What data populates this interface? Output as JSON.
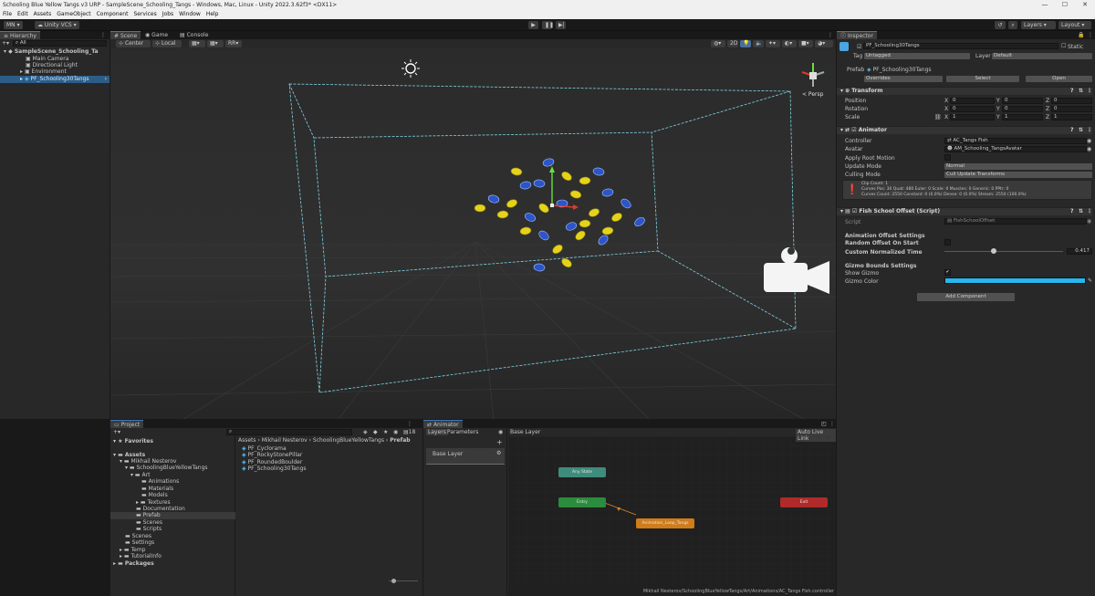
{
  "window": {
    "title": "Schooling Blue Yellow Tangs v3 URP - SampleScene_Schooling_Tangs - Windows, Mac, Linux - Unity 2022.3.62f3* <DX11>",
    "controls": [
      "—",
      "☐",
      "✕"
    ]
  },
  "menu": [
    "File",
    "Edit",
    "Assets",
    "GameObject",
    "Component",
    "Services",
    "Jobs",
    "Window",
    "Help"
  ],
  "toolbar": {
    "account": "MN",
    "vcs": "Unity VCS",
    "layers": "Layers",
    "layout": "Layout"
  },
  "hierarchy": {
    "tab": "Hierarchy",
    "search_placeholder": "All",
    "scene": "SampleScene_Schooling_Ta",
    "items": [
      "Main Camera",
      "Directional Light",
      "Environment",
      "PF_Schooling30Tangs"
    ]
  },
  "scene_view": {
    "tabs": [
      "Scene",
      "Game",
      "Console"
    ],
    "pivot": "Center",
    "space": "Local",
    "mode_2d": "2D",
    "persp": "< Persp",
    "render": "RR"
  },
  "inspector": {
    "tab": "Inspector",
    "object_name": "PF_Schooling30Tangs",
    "static_label": "Static",
    "tag_label": "Tag",
    "tag_value": "Untagged",
    "layer_label": "Layer",
    "layer_value": "Default",
    "prefab_label": "Prefab",
    "prefab_value": "PF_Schooling30Tangs",
    "overrides": "Overrides",
    "select": "Select",
    "open": "Open",
    "transform": {
      "title": "Transform",
      "position_label": "Position",
      "rotation_label": "Rotation",
      "scale_label": "Scale",
      "position": [
        "0",
        "0",
        "0"
      ],
      "rotation": [
        "0",
        "0",
        "0"
      ],
      "scale": [
        "1",
        "1",
        "1"
      ],
      "x": "X",
      "y": "Y",
      "z": "Z"
    },
    "animator": {
      "title": "Animator",
      "controller_label": "Controller",
      "controller": "AC_Tangs Fish",
      "avatar_label": "Avatar",
      "avatar": "AM_Schooling_TangsAvatar",
      "apply_root_motion_label": "Apply Root Motion",
      "update_mode_label": "Update Mode",
      "update_mode": "Normal",
      "culling_mode_label": "Culling Mode",
      "culling_mode": "Cull Update Transforms",
      "info_1": "Clip Count: 1",
      "info_2": "Curves Pos: 30 Quat: 480 Euler: 0 Scale: 0 Muscles: 0 Generic: 0 PPtr: 0",
      "info_3": "Curves Count: 2550 Constant: 0 (0.0%) Dense: 0 (0.0%) Stream: 2550 (100.0%)"
    },
    "fish_school": {
      "title": "Fish School Offset (Script)",
      "script_label": "Script",
      "script": "FishSchoolOffset",
      "anim_settings": "Animation Offset Settings",
      "random_offset_label": "Random Offset On Start",
      "custom_time_label": "Custom Normalized Time",
      "custom_time": "0.417",
      "custom_time_fraction": 0.417,
      "gizmo_settings": "Gizmo Bounds Settings",
      "show_gizmo_label": "Show Gizmo",
      "gizmo_color_label": "Gizmo Color",
      "gizmo_color": "#27b6ee"
    },
    "add_component": "Add Component"
  },
  "project": {
    "tab": "Project",
    "favorites": "Favorites",
    "tree": [
      "Assets",
      "Mikhail Nesterov",
      "SchoolingBlueYellowTangs",
      "Art",
      "Animations",
      "Materials",
      "Models",
      "Textures",
      "Documentation",
      "Prefab",
      "Scenes",
      "Scripts",
      "Scenes",
      "Settings",
      "Temp",
      "TutorialInfo",
      "Packages"
    ],
    "breadcrumb": [
      "Assets",
      "Mikhail Nesterov",
      "SchoolingBlueYellowTangs",
      "Prefab"
    ],
    "files": [
      "PF_Cyclorama",
      "PF_RockyStonePillar",
      "PF_RoundedBoulder",
      "PF_Schooling30Tangs"
    ],
    "count": "18"
  },
  "animator_window": {
    "tab": "Animator",
    "layers_tab": "Layers",
    "parameters_tab": "Parameters",
    "layer_crumb": "Base Layer",
    "auto_live_link": "Auto Live Link",
    "base_layer": "Base Layer",
    "states": {
      "any": "Any State",
      "entry": "Entry",
      "exit": "Exit",
      "main": "Animation_Loop_Tangs"
    },
    "path": "Mikhail Nesterov/SchoolingBlueYellowTangs/Art/Animations/AC_Tangs Fish.controller"
  },
  "colors": {
    "accent": "#3a79bb",
    "selection": "#2c5d87",
    "bounds": "#7fd3e6",
    "any_state": "#4a9a8a",
    "entry": "#2a8c3c",
    "exit": "#b02a2a",
    "default_state": "#d07c1a"
  }
}
